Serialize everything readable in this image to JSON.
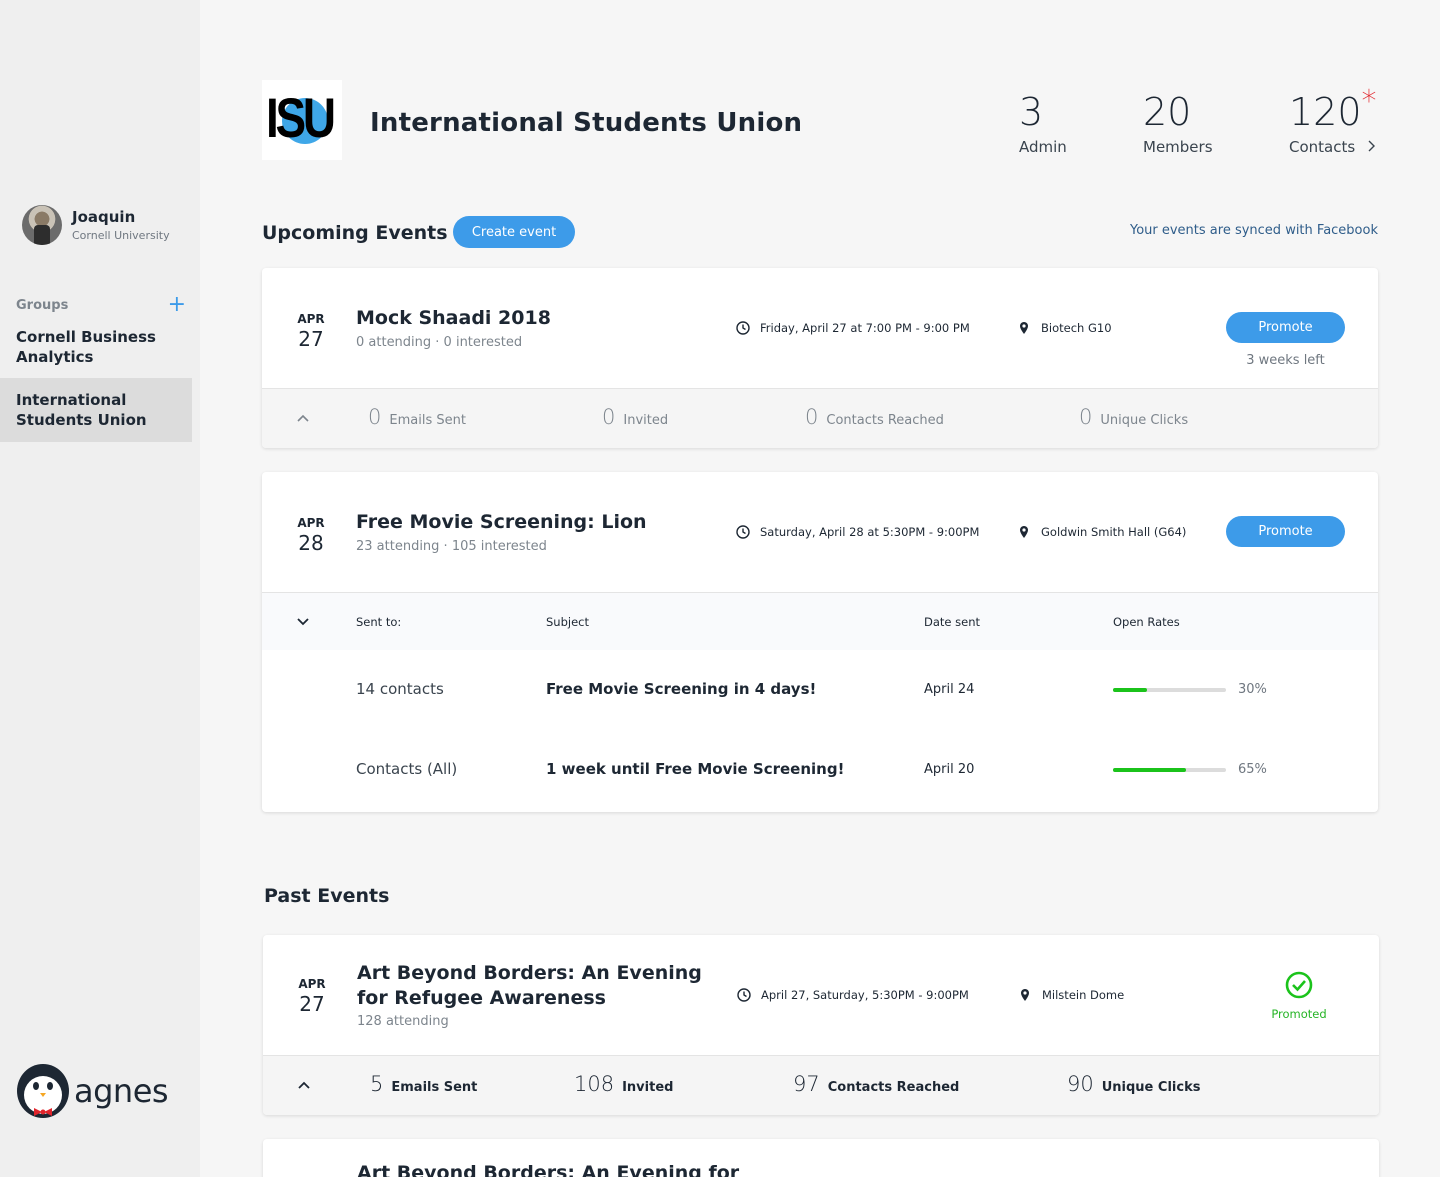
{
  "user": {
    "name": "Joaquin",
    "org": "Cornell University"
  },
  "groups": {
    "label": "Groups",
    "add_icon": "plus-icon",
    "items": [
      "Cornell Business Analytics",
      "International Students Union"
    ]
  },
  "brand": {
    "name": "agnes"
  },
  "org": {
    "logo_text": "ISU",
    "title": "International Students Union",
    "stats": [
      {
        "value": "3",
        "label": "Admin"
      },
      {
        "value": "20",
        "label": "Members"
      },
      {
        "value": "120",
        "label": "Contacts",
        "asterisk": "*"
      }
    ]
  },
  "upcoming": {
    "title": "Upcoming Events",
    "create_label": "Create event",
    "sync_note": "Your events are synced with Facebook",
    "events": [
      {
        "month": "APR",
        "day": "27",
        "title": "Mock Shaadi 2018",
        "sub": "0 attending  ·  0 interested",
        "time": "Friday, April 27 at 7:00 PM - 9:00 PM",
        "location": "Biotech G10",
        "promote_label": "Promote",
        "weeks_left": "3 weeks left",
        "stats": [
          {
            "value": "0",
            "label": "Emails Sent"
          },
          {
            "value": "0",
            "label": "Invited"
          },
          {
            "value": "0",
            "label": "Contacts Reached"
          },
          {
            "value": "0",
            "label": "Unique Clicks"
          }
        ]
      },
      {
        "month": "APR",
        "day": "28",
        "title": "Free Movie Screening: Lion",
        "sub": "23 attending · 105 interested",
        "time": "Saturday, April 28 at 5:30PM - 9:00PM",
        "location": "Goldwin Smith Hall (G64)",
        "promote_label": "Promote",
        "table": {
          "headers": [
            "Sent to:",
            "Subject",
            "Date sent",
            "Open Rates"
          ],
          "rows": [
            {
              "sent_to": "14 contacts",
              "subject": "Free Movie Screening in 4 days!",
              "date": "April 24",
              "rate": 0.3,
              "rate_label": "30%"
            },
            {
              "sent_to": "Contacts (All)",
              "subject": "1 week until Free Movie Screening!",
              "date": "April 20",
              "rate": 0.65,
              "rate_label": "65%"
            }
          ]
        }
      }
    ]
  },
  "past": {
    "title": "Past Events",
    "events": [
      {
        "month": "APR",
        "day": "27",
        "title": "Art Beyond Borders: An Evening for Refugee Awareness",
        "sub": "128 attending",
        "time": "April 27, Saturday, 5:30PM - 9:00PM",
        "location": "Milstein Dome",
        "status": "Promoted",
        "stats": [
          {
            "value": "5",
            "label": "Emails Sent"
          },
          {
            "value": "108",
            "label": "Invited"
          },
          {
            "value": "97",
            "label": "Contacts Reached"
          },
          {
            "value": "90",
            "label": "Unique Clicks"
          }
        ]
      },
      {
        "title": "Art Beyond Borders: An Evening for"
      }
    ]
  },
  "colors": {
    "accent": "#3d9be9",
    "success": "#1bc31b",
    "alert": "#e0252c"
  }
}
